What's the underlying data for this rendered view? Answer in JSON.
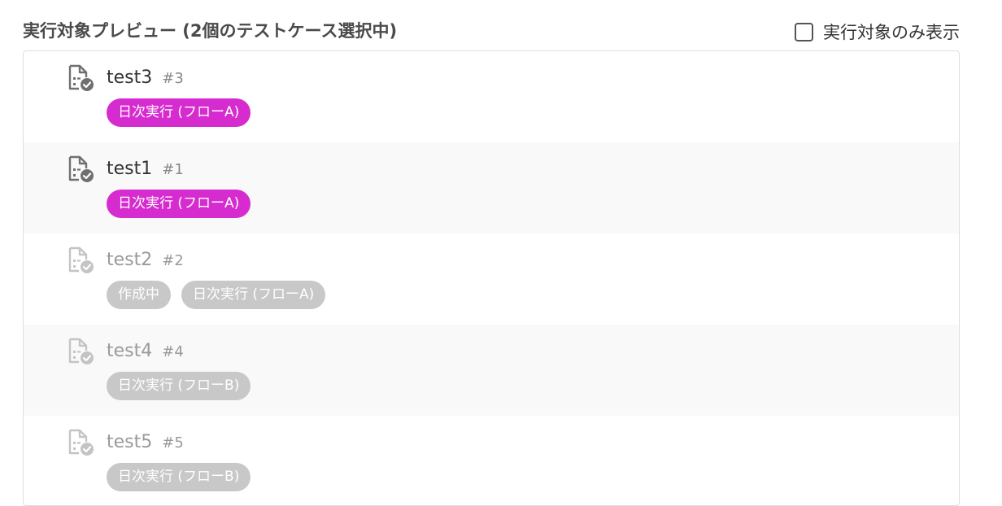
{
  "header": {
    "title": "実行対象プレビュー (2個のテストケース選択中)",
    "filter_label": "実行対象のみ表示",
    "filter_checked": false
  },
  "rows": [
    {
      "name": "test3",
      "number": "#3",
      "active": true,
      "tags": [
        "日次実行 (フローA)"
      ]
    },
    {
      "name": "test1",
      "number": "#1",
      "active": true,
      "tags": [
        "日次実行 (フローA)"
      ]
    },
    {
      "name": "test2",
      "number": "#2",
      "active": false,
      "tags": [
        "作成中",
        "日次実行 (フローA)"
      ]
    },
    {
      "name": "test4",
      "number": "#4",
      "active": false,
      "tags": [
        "日次実行 (フローB)"
      ]
    },
    {
      "name": "test5",
      "number": "#5",
      "active": false,
      "tags": [
        "日次実行 (フローB)"
      ]
    }
  ],
  "colors": {
    "active_tag": "#d62ccf",
    "inactive_tag": "#c8c8c8",
    "active_icon": "#707070",
    "inactive_icon": "#c4c4c4"
  },
  "icons": {
    "row_icon": "test-case-document-check-icon"
  }
}
